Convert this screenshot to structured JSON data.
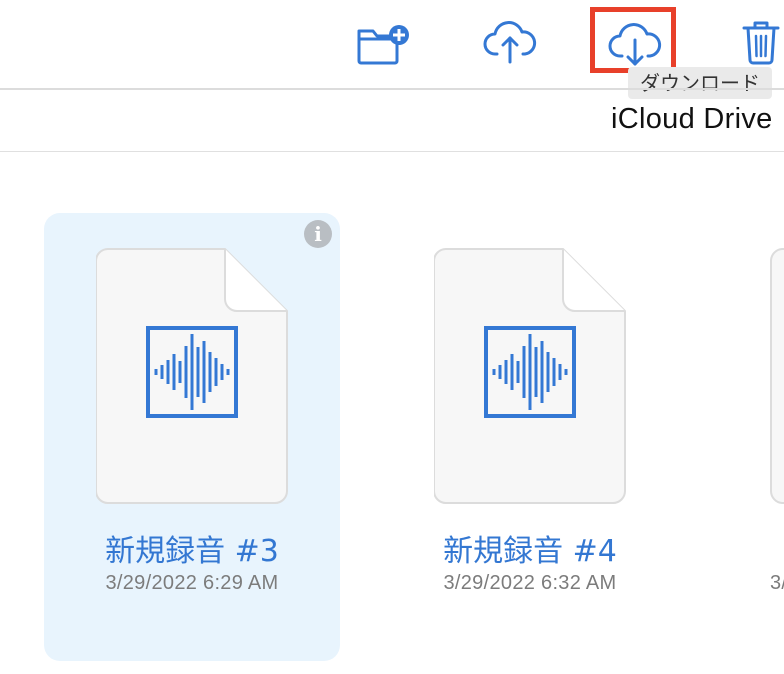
{
  "toolbar": {
    "buttons": [
      {
        "name": "new-folder",
        "icon": "folder-plus-icon"
      },
      {
        "name": "upload",
        "icon": "cloud-upload-icon"
      },
      {
        "name": "download",
        "icon": "cloud-download-icon"
      },
      {
        "name": "delete",
        "icon": "trash-icon"
      }
    ],
    "tooltip": "ダウンロード",
    "accent_color": "#3478d4",
    "highlight_color": "#e8402a"
  },
  "location": {
    "title": "iCloud Drive"
  },
  "files": [
    {
      "name": "新規録音 #3",
      "date": "3/29/2022 6:29 AM",
      "selected": true,
      "icon": "audio-waveform-icon"
    },
    {
      "name": "新規録音 #4",
      "date": "3/29/2022 6:32 AM",
      "selected": false,
      "icon": "audio-waveform-icon"
    },
    {
      "name": "",
      "date": "3/",
      "selected": false,
      "icon": "document-icon"
    }
  ],
  "info_badge": "i"
}
